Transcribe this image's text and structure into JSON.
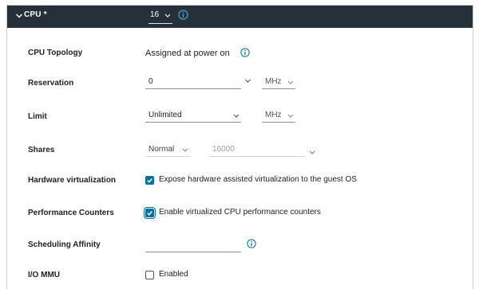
{
  "header": {
    "title": "CPU *",
    "cpu_count": "16"
  },
  "rows": {
    "topology": {
      "label": "CPU Topology",
      "value": "Assigned at power on"
    },
    "reservation": {
      "label": "Reservation",
      "value": "0",
      "unit": "MHz"
    },
    "limit": {
      "label": "Limit",
      "value": "Unlimited",
      "unit": "MHz"
    },
    "shares": {
      "label": "Shares",
      "level": "Normal",
      "value": "16000"
    },
    "hw_virt": {
      "label": "Hardware virtualization",
      "text": "Expose hardware assisted virtualization to the guest OS",
      "checked": true
    },
    "perf": {
      "label": "Performance Counters",
      "text": "Enable virtualized CPU performance counters",
      "checked": true
    },
    "affinity": {
      "label": "Scheduling Affinity",
      "value": ""
    },
    "iommu": {
      "label": "I/O MMU",
      "text": "Enabled",
      "checked": false
    }
  },
  "colors": {
    "header_bg": "#25303a",
    "accent": "#0072a3"
  },
  "icons": [
    "chevron-down-icon",
    "info-icon",
    "checkmark-icon"
  ]
}
